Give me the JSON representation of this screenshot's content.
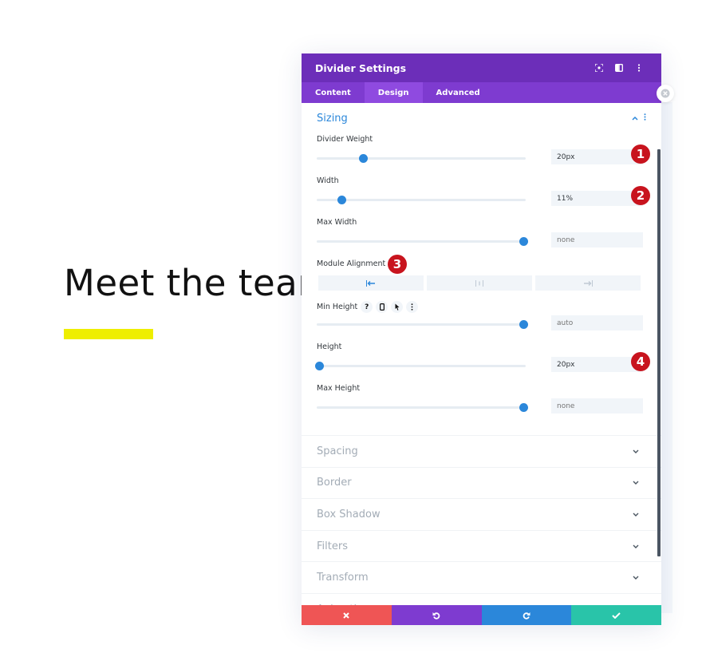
{
  "background": {
    "heading": "Meet the team",
    "accent_bar_color": "#eeee00"
  },
  "panel": {
    "title": "Divider Settings",
    "header_icons": [
      "focus-icon",
      "split-view-icon",
      "more-options-icon"
    ],
    "tabs": [
      {
        "label": "Content",
        "active": false
      },
      {
        "label": "Design",
        "active": true
      },
      {
        "label": "Advanced",
        "active": false
      }
    ],
    "sizing": {
      "title": "Sizing",
      "fields": [
        {
          "label": "Divider Weight",
          "value": "20px",
          "slider_percent": 21,
          "badge": "1"
        },
        {
          "label": "Width",
          "value": "11%",
          "slider_percent": 11,
          "badge": "2"
        },
        {
          "label": "Max Width",
          "placeholder": "none",
          "slider_percent": 98
        }
      ],
      "module_alignment": {
        "label": "Module Alignment",
        "options": [
          "left",
          "center",
          "right"
        ],
        "selected": "left",
        "badge": "3"
      },
      "fields2": [
        {
          "label": "Min Height",
          "placeholder": "auto",
          "slider_percent": 98,
          "icons": [
            "?",
            "device",
            "cursor",
            "more"
          ]
        },
        {
          "label": "Height",
          "value": "20px",
          "slider_percent": 0,
          "badge": "4"
        },
        {
          "label": "Max Height",
          "placeholder": "none",
          "slider_percent": 98
        }
      ]
    },
    "collapsed_sections": [
      "Spacing",
      "Border",
      "Box Shadow",
      "Filters",
      "Transform",
      "Animation"
    ],
    "footer": {
      "cancel_color": "#ef5555",
      "undo_color": "#7e3bd0",
      "redo_color": "#2b87da",
      "save_color": "#29c4a9"
    },
    "colors": {
      "header": "#6c2eb9",
      "tabs": "#7e3bd0",
      "accent": "#2b87da",
      "badge": "#c8141e"
    }
  }
}
